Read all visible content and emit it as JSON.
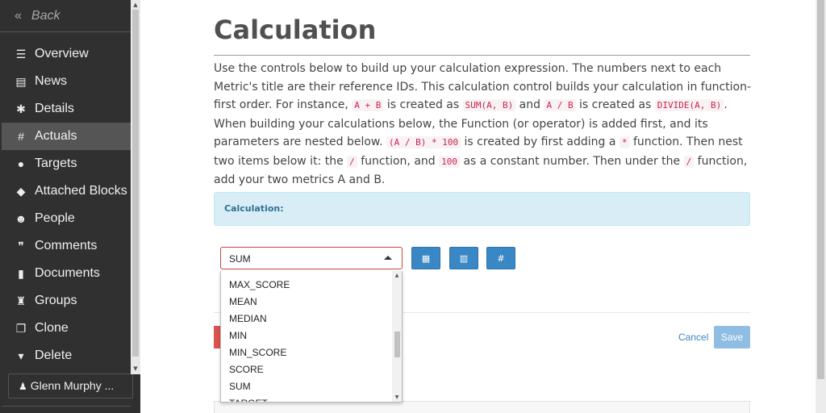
{
  "sidebar": {
    "back_label": "Back",
    "items": [
      {
        "label": "Overview",
        "icon": "list-icon"
      },
      {
        "label": "News",
        "icon": "newspaper-icon"
      },
      {
        "label": "Details",
        "icon": "gear-icon"
      },
      {
        "label": "Actuals",
        "icon": "hash-icon"
      },
      {
        "label": "Targets",
        "icon": "pin-icon"
      },
      {
        "label": "Attached Blocks",
        "icon": "cube-icon"
      },
      {
        "label": "People",
        "icon": "people-icon"
      },
      {
        "label": "Comments",
        "icon": "comments-icon"
      },
      {
        "label": "Documents",
        "icon": "file-icon"
      },
      {
        "label": "Groups",
        "icon": "groups-icon"
      },
      {
        "label": "Clone",
        "icon": "clone-icon"
      },
      {
        "label": "Delete",
        "icon": "trash-icon"
      }
    ],
    "active_index": 3,
    "user_label": "Glenn Murphy ..."
  },
  "main": {
    "title": "Calculation",
    "description": {
      "p1": "Use the controls below to build up your calculation expression. The numbers next to each Metric's title are their reference IDs. This calculation control builds your calculation in function-first order. For instance, ",
      "c1": "A + B",
      "p2": " is created as ",
      "c2": "SUM(A, B)",
      "p3": " and ",
      "c3": "A / B",
      "p4": " is created as ",
      "c4": "DIVIDE(A, B)",
      "p5": ". When building your calculations below, the Function (or operator) is added first, and its parameters are nested below. ",
      "c5": "(A / B) * 100",
      "p6": " is created by first adding a ",
      "c6": "*",
      "p7": " function. Then nest two items below it: the ",
      "c7": "/",
      "p8": " function, and ",
      "c8": "100",
      "p9": " as a constant number. Then under the ",
      "c9": "/",
      "p10": " function, add your two metrics A and B."
    },
    "calculation_label": "Calculation:",
    "select_value": "SUM",
    "tool_buttons": [
      {
        "icon": "calculator-icon",
        "glyph": "▦"
      },
      {
        "icon": "bar-chart-icon",
        "glyph": "▥"
      },
      {
        "icon": "hash-icon",
        "glyph": "#"
      }
    ],
    "dropdown_options": [
      "MAX_SCORE",
      "MEAN",
      "MEDIAN",
      "MIN",
      "MIN_SCORE",
      "SCORE",
      "SUM",
      "TARGET"
    ],
    "cancel_label": "Cancel",
    "save_label": "Save"
  }
}
